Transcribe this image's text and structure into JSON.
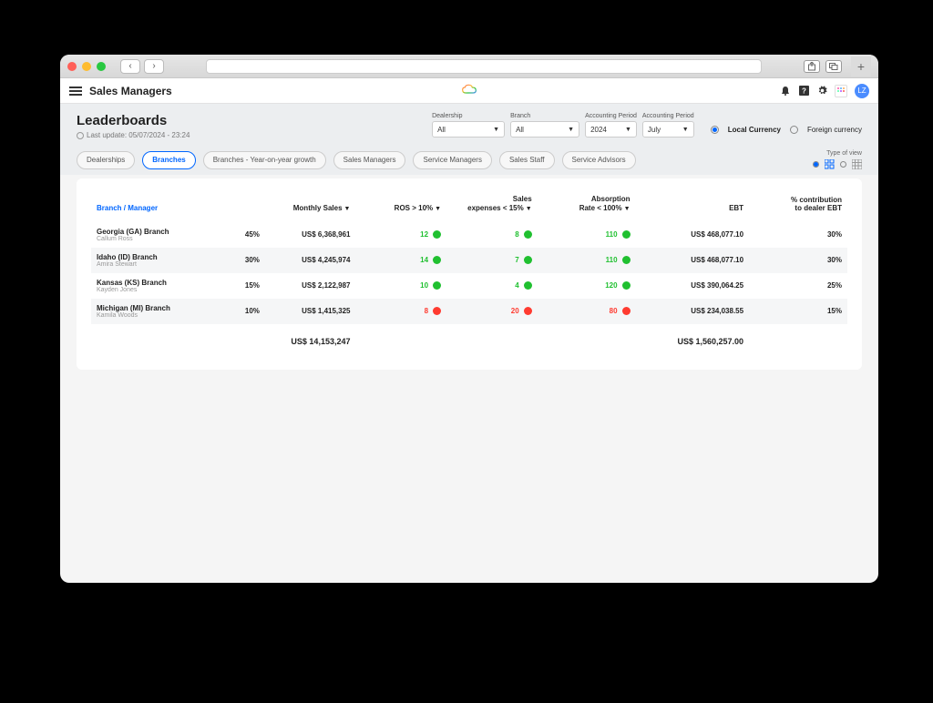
{
  "app": {
    "title": "Sales Managers",
    "avatar_initials": "LZ"
  },
  "page": {
    "heading": "Leaderboards",
    "last_update_label": "Last update: 05/07/2024 - 23:24"
  },
  "filters": {
    "dealership": {
      "label": "Dealership",
      "value": "All"
    },
    "branch": {
      "label": "Branch",
      "value": "All"
    },
    "period_year": {
      "label": "Accounting Period",
      "value": "2024"
    },
    "period_month": {
      "label": "Accounting Period",
      "value": "July"
    },
    "currency_local": "Local Currency",
    "currency_foreign": "Foreign currency"
  },
  "tabs": {
    "t0": "Dealerships",
    "t1": "Branches",
    "t2": "Branches - Year-on-year growth",
    "t3": "Sales Managers",
    "t4": "Service Managers",
    "t5": "Sales Staff",
    "t6": "Service Advisors"
  },
  "view_toggle_label": "Type of view",
  "columns": {
    "branch": "Branch / Manager",
    "monthly_sales": "Monthly Sales",
    "ros": "ROS > 10%",
    "sales_exp_line1": "Sales",
    "sales_exp_line2": "expenses < 15%",
    "abs_line1": "Absorption",
    "abs_line2": "Rate < 100%",
    "ebt": "EBT",
    "contrib_line1": "% contribution",
    "contrib_line2": "to dealer EBT"
  },
  "rows": [
    {
      "branch": "Georgia (GA) Branch",
      "manager": "Callum Ross",
      "pct": "45%",
      "sales": "US$ 6,368,961",
      "ros": "12",
      "ros_status": "green",
      "exp": "8",
      "exp_status": "green",
      "abs": "110",
      "abs_status": "green",
      "ebt": "US$ 468,077.10",
      "contrib": "30%"
    },
    {
      "branch": "Idaho (ID) Branch",
      "manager": "Amira Stewart",
      "pct": "30%",
      "sales": "US$ 4,245,974",
      "ros": "14",
      "ros_status": "green",
      "exp": "7",
      "exp_status": "green",
      "abs": "110",
      "abs_status": "green",
      "ebt": "US$ 468,077.10",
      "contrib": "30%"
    },
    {
      "branch": "Kansas (KS) Branch",
      "manager": "Kayden Jones",
      "pct": "15%",
      "sales": "US$ 2,122,987",
      "ros": "10",
      "ros_status": "green",
      "exp": "4",
      "exp_status": "green",
      "abs": "120",
      "abs_status": "green",
      "ebt": "US$ 390,064.25",
      "contrib": "25%"
    },
    {
      "branch": "Michigan (MI) Branch",
      "manager": "Kamila Woods",
      "pct": "10%",
      "sales": "US$ 1,415,325",
      "ros": "8",
      "ros_status": "red",
      "exp": "20",
      "exp_status": "red",
      "abs": "80",
      "abs_status": "red",
      "ebt": "US$ 234,038.55",
      "contrib": "15%"
    }
  ],
  "totals": {
    "sales": "US$ 14,153,247",
    "ebt": "US$ 1,560,257.00"
  }
}
